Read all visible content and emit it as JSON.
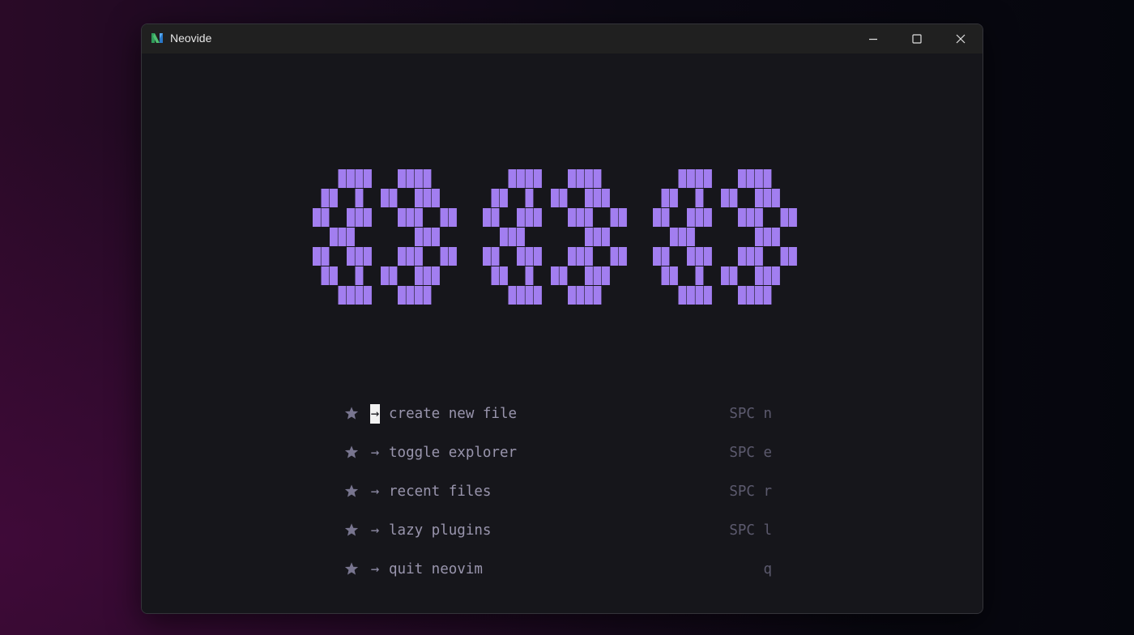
{
  "window": {
    "title": "Neovide",
    "icon": "neovide-logo-icon",
    "controls": [
      "minimize-icon",
      "maximize-icon",
      "close-icon"
    ]
  },
  "dashboard": {
    "logo": "pixel-art-logo",
    "accent_color": "#a27ef0",
    "menu": [
      {
        "icon": "star-icon",
        "arrow": "→",
        "label": "create new file",
        "key": "SPC n"
      },
      {
        "icon": "star-icon",
        "arrow": "→",
        "label": "toggle explorer",
        "key": "SPC e"
      },
      {
        "icon": "star-icon",
        "arrow": "→",
        "label": "recent files",
        "key": "SPC r"
      },
      {
        "icon": "star-icon",
        "arrow": "→",
        "label": "lazy plugins",
        "key": "SPC l"
      },
      {
        "icon": "star-icon",
        "arrow": "→",
        "label": "quit neovim",
        "key": "q"
      }
    ]
  }
}
